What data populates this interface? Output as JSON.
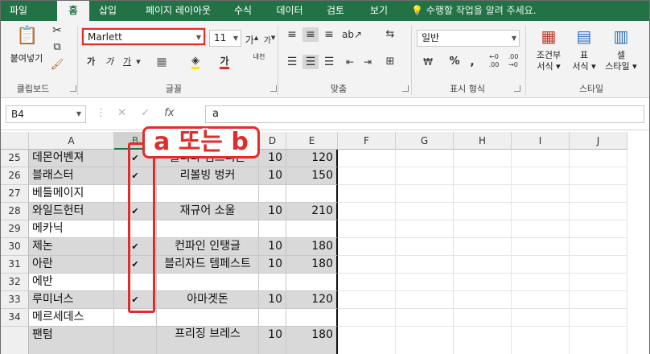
{
  "menu": {
    "tabs": [
      "파일",
      "홈",
      "삽입",
      "페이지 레이아웃",
      "수식",
      "데이터",
      "검토",
      "보기"
    ],
    "active": "홈",
    "tell_me": "수행할 작업을 알려 주세요."
  },
  "ribbon": {
    "clipboard": {
      "paste_label": "붙여넣기",
      "group_label": "클립보드"
    },
    "font": {
      "name": "Marlett",
      "size": "11",
      "group_label": "글꼴",
      "bold": "가",
      "italic": "가",
      "underline": "가",
      "grow": "가",
      "shrink": "가",
      "font_color_char": "가",
      "phonetic": "내천"
    },
    "alignment": {
      "group_label": "맞춤"
    },
    "number": {
      "format": "일반",
      "group_label": "표시 형식",
      "currency": "₩",
      "percent": "%",
      "comma": ","
    },
    "styles": {
      "group_label": "스타일",
      "cond_format": [
        "조건부",
        "서식"
      ],
      "table_format": [
        "표",
        "서식"
      ],
      "cell_style": [
        "셀",
        "스타일"
      ]
    }
  },
  "formula_bar": {
    "name_box": "B4",
    "fx": "fx",
    "content": "a",
    "cancel": "✕",
    "enter": "✓"
  },
  "grid": {
    "columns": [
      "A",
      "B",
      "C",
      "D",
      "E",
      "F",
      "G",
      "H",
      "I",
      "J"
    ],
    "selected_column": "B",
    "rows": [
      {
        "num": "25",
        "a": "데몬어벤져",
        "b": "✔",
        "c": "블리다 엠프리온",
        "d": "10",
        "e": "120",
        "shaded": true
      },
      {
        "num": "26",
        "a": "블래스터",
        "b": "✔",
        "c": "리볼빙 벙커",
        "d": "10",
        "e": "150",
        "shaded": true
      },
      {
        "num": "27",
        "a": "베틀메이지",
        "b": "",
        "c": "",
        "d": "",
        "e": "",
        "shaded": false
      },
      {
        "num": "28",
        "a": "와일드헌터",
        "b": "✔",
        "c": "재규어 소울",
        "d": "10",
        "e": "210",
        "shaded": true
      },
      {
        "num": "29",
        "a": "메카닉",
        "b": "",
        "c": "",
        "d": "",
        "e": "",
        "shaded": false
      },
      {
        "num": "30",
        "a": "제논",
        "b": "✔",
        "c": "컨파인 인탱글",
        "d": "10",
        "e": "180",
        "shaded": true
      },
      {
        "num": "31",
        "a": "아란",
        "b": "✔",
        "c": "블리자드 템페스트",
        "d": "10",
        "e": "180",
        "shaded": true
      },
      {
        "num": "32",
        "a": "에반",
        "b": "",
        "c": "",
        "d": "",
        "e": "",
        "shaded": false
      },
      {
        "num": "33",
        "a": "루미너스",
        "b": "✔",
        "c": "아마겟돈",
        "d": "10",
        "e": "120",
        "shaded": true
      },
      {
        "num": "34",
        "a": "메르세데스",
        "b": "",
        "c": "",
        "d": "",
        "e": "",
        "shaded": false
      },
      {
        "num": "",
        "a": "팬텀",
        "b": "",
        "c": "프리징 브레스",
        "d": "10",
        "e": "180",
        "shaded": true
      }
    ]
  },
  "annotation": {
    "callout": "a 또는 b",
    "color": "#e32b2b"
  },
  "colors": {
    "excel_green": "#217346",
    "highlight_red": "#e32b2b",
    "cell_shade": "#d9d9d9"
  }
}
